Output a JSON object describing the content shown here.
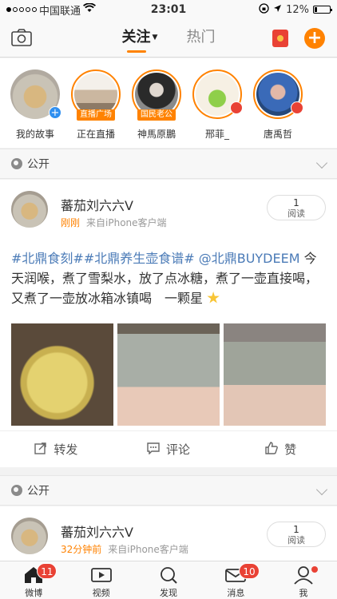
{
  "status_bar": {
    "carrier": "中国联通",
    "time": "23:01",
    "battery": "12%"
  },
  "nav": {
    "tabs": [
      {
        "label": "关注",
        "active": true
      },
      {
        "label": "热门",
        "active": false
      }
    ],
    "accent_color": "#ff8200"
  },
  "stories": [
    {
      "name": "我的故事",
      "tag": ""
    },
    {
      "name": "正在直播",
      "tag": "直播广场"
    },
    {
      "name": "神馬原鵬",
      "tag": "国民老公"
    },
    {
      "name": "邢菲_",
      "tag": ""
    },
    {
      "name": "唐禹哲",
      "tag": ""
    }
  ],
  "sections": [
    {
      "label": "公开"
    },
    {
      "label": "公开"
    }
  ],
  "posts": [
    {
      "author": "蕃茄刘六六V",
      "time": "刚刚",
      "source": "来自iPhone客户端",
      "reads": "1",
      "reads_label": "阅读",
      "topic_text": "#北鼎食刻##北鼎养生壶食谱# @北鼎BUYDEEM",
      "body_text": " 今天润喉，煮了雪梨水，放了点冰糖，煮了一壶直接喝，又煮了一壶放冰箱冰镇喝　一颗星",
      "actions": {
        "repost": "转发",
        "comment": "评论",
        "like": "赞"
      }
    },
    {
      "author": "蕃茄刘六六V",
      "time": "32分钟前",
      "source": "来自iPhone客户端",
      "reads": "1",
      "reads_label": "阅读"
    }
  ],
  "tabbar": [
    {
      "label": "微博",
      "badge": "11",
      "icon": "home-icon"
    },
    {
      "label": "视频",
      "badge": "",
      "icon": "video-icon"
    },
    {
      "label": "发现",
      "badge": "",
      "icon": "search-icon"
    },
    {
      "label": "消息",
      "badge": "10",
      "icon": "mail-icon"
    },
    {
      "label": "我",
      "badge": "",
      "icon": "profile-icon"
    }
  ]
}
